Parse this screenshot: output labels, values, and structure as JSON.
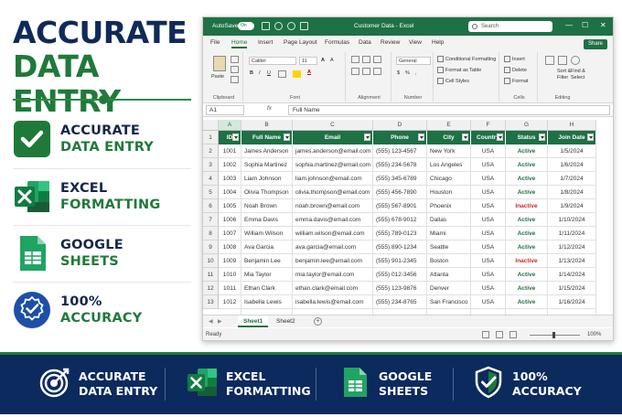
{
  "hero": {
    "line1": "ACCURATE",
    "line2": "DATA ENTRY"
  },
  "features": [
    {
      "icon": "check-icon",
      "line1": "ACCURATE",
      "line2": "DATA ENTRY"
    },
    {
      "icon": "excel-logo-icon",
      "line1": "EXCEL",
      "line2": "FORMATTING"
    },
    {
      "icon": "google-sheets-icon",
      "line1": "GOOGLE",
      "line2": "SHEETS"
    },
    {
      "icon": "verified-badge-icon",
      "line1": "100%",
      "line2": "ACCURACY"
    }
  ],
  "excel": {
    "autosave": "AutoSave",
    "toggle": "On",
    "doc_title": "Customer Data - Excel",
    "search_placeholder": "Search",
    "window_controls": {
      "minimize": "—",
      "maximize": "☐",
      "close": "✕"
    },
    "menu": [
      "File",
      "Home",
      "Insert",
      "Page Layout",
      "Formulas",
      "Data",
      "Review",
      "View",
      "Help"
    ],
    "share": "Share",
    "ribbon": {
      "clipboard": {
        "label": "Clipboard",
        "paste": "Paste"
      },
      "font": {
        "label": "Font",
        "name": "Calibri",
        "size": "11"
      },
      "alignment": {
        "label": "Alignment"
      },
      "number": {
        "label": "Number",
        "format": "General"
      },
      "styles": {
        "cond": "Conditional Formatting",
        "table": "Format as Table",
        "cell": "Cell Styles"
      },
      "cells": {
        "label": "Cells",
        "insert": "Insert",
        "delete": "Delete",
        "format": "Format"
      },
      "editing": {
        "label": "Editing",
        "sort": "Sort &",
        "filter": "Filter",
        "find": "Find &",
        "select": "Select"
      }
    },
    "namebox": "A1",
    "fx": "fx",
    "formula": "Full Name",
    "columns": [
      "A",
      "B",
      "C",
      "D",
      "E",
      "F",
      "G",
      "H"
    ],
    "headers": [
      "ID",
      "Full Name",
      "Email",
      "Phone",
      "City",
      "Country",
      "Status",
      "Join Date"
    ],
    "rows": [
      [
        "1001",
        "James Anderson",
        "james.anderson@email.com",
        "(555) 123-4567",
        "New York",
        "USA",
        "Active",
        "1/5/2024"
      ],
      [
        "1002",
        "Sophia Martinez",
        "sophia.martinez@email.com",
        "(555) 234-5678",
        "Los Angeles",
        "USA",
        "Active",
        "1/6/2024"
      ],
      [
        "1003",
        "Liam Johnson",
        "liam.johnson@email.com",
        "(555) 345-6789",
        "Chicago",
        "USA",
        "Active",
        "1/7/2024"
      ],
      [
        "1004",
        "Olivia Thompson",
        "olivia.thompson@email.com",
        "(555) 456-7890",
        "Houston",
        "USA",
        "Active",
        "1/8/2024"
      ],
      [
        "1005",
        "Noah Brown",
        "noah.brown@email.com",
        "(555) 567-8901",
        "Phoenix",
        "USA",
        "Inactive",
        "1/9/2024"
      ],
      [
        "1006",
        "Emma Davis",
        "emma.davis@email.com",
        "(555) 678-9012",
        "Dallas",
        "USA",
        "Active",
        "1/10/2024"
      ],
      [
        "1007",
        "William Wilson",
        "william.wilson@email.com",
        "(555) 789-0123",
        "Miami",
        "USA",
        "Active",
        "1/11/2024"
      ],
      [
        "1008",
        "Ava Garcia",
        "ava.garcia@email.com",
        "(555) 890-1234",
        "Seattle",
        "USA",
        "Active",
        "1/12/2024"
      ],
      [
        "1009",
        "Benjamin Lee",
        "benjamin.lee@email.com",
        "(555) 901-2345",
        "Boston",
        "USA",
        "Inactive",
        "1/13/2024"
      ],
      [
        "1010",
        "Mia Taylor",
        "mia.taylor@email.com",
        "(555) 012-3456",
        "Atlanta",
        "USA",
        "Active",
        "1/14/2024"
      ],
      [
        "1011",
        "Ethan Clark",
        "ethan.clark@email.com",
        "(555) 123-9876",
        "Denver",
        "USA",
        "Active",
        "1/15/2024"
      ],
      [
        "1012",
        "Isabella Lewis",
        "isabella.lewis@email.com",
        "(555) 234-8765",
        "San Francisco",
        "USA",
        "Active",
        "1/16/2024"
      ]
    ],
    "row_numbers": [
      "1",
      "2",
      "3",
      "4",
      "5",
      "6",
      "7",
      "8",
      "9",
      "10",
      "11",
      "12",
      "13"
    ],
    "sheets": [
      "Sheet1",
      "Sheet2"
    ],
    "add_sheet": "+",
    "status": "Ready",
    "zoom": "100%"
  },
  "banner": [
    {
      "icon": "target-icon",
      "line1": "ACCURATE",
      "line2": "DATA ENTRY"
    },
    {
      "icon": "excel-logo-icon",
      "line1": "EXCEL",
      "line2": "FORMATTING"
    },
    {
      "icon": "google-sheets-icon",
      "line1": "GOOGLE",
      "line2": "SHEETS"
    },
    {
      "icon": "shield-check-icon",
      "line1": "100%",
      "line2": "ACCURACY"
    }
  ],
  "colors": {
    "navy": "#0c2a5e",
    "green": "#1f7a3a",
    "excel_green": "#1e7145",
    "inactive_red": "#c62828"
  }
}
